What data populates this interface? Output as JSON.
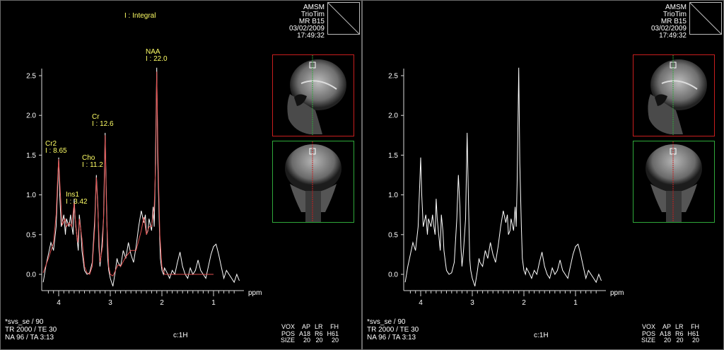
{
  "legend": "I : Integral",
  "info_lines": [
    "AMSM",
    "TrioTim",
    "MR B15",
    "03/02/2009",
    "17:49:32"
  ],
  "x_unit": "ppm",
  "x_ticks": [
    "4",
    "3",
    "2",
    "1"
  ],
  "y_ticks": [
    "0.0",
    "0.5",
    "1.0",
    "1.5",
    "2.0",
    "2.5"
  ],
  "peaks": [
    {
      "name": "Cr2",
      "integral": "I : 8.65"
    },
    {
      "name": "Ins1",
      "integral": "I : 3.42"
    },
    {
      "name": "Cho",
      "integral": "I : 11.2"
    },
    {
      "name": "Cr",
      "integral": "I : 12.6"
    },
    {
      "name": "NAA",
      "integral": "I : 22.0"
    }
  ],
  "protocol_lines": [
    "*svs_se / 90",
    "TR 2000 / TE 30",
    "NA 96 / TA 3:13"
  ],
  "nucleus": "c:1H",
  "voxel_table": {
    "headers": [
      "VOX",
      "AP",
      "LR",
      "FH"
    ],
    "rows": [
      [
        "POS",
        "A18",
        "R6",
        "H61"
      ],
      [
        "SIZE",
        "20",
        "20",
        "20"
      ]
    ]
  },
  "colors": {
    "spectrum": "#ffffff",
    "fit": "#e05050",
    "annotation": "#ffff66",
    "sagittal_frame": "#c81e1e",
    "coronal_frame": "#2fa83a"
  },
  "chart_data": [
    {
      "type": "line",
      "x_axis": "ppm (reversed)",
      "xlim": [
        4.3,
        0.45
      ],
      "ylim": [
        -0.2,
        2.6
      ],
      "x_ticks": [
        4,
        3,
        2,
        1
      ],
      "y_ticks": [
        0,
        0.5,
        1.0,
        1.5,
        2.0,
        2.5
      ],
      "series": [
        {
          "x": [
            4.3,
            4.25,
            4.2,
            4.15,
            4.1,
            4.05,
            4.02,
            4.0,
            3.98,
            3.95,
            3.9,
            3.87,
            3.85,
            3.8,
            3.77,
            3.75,
            3.72,
            3.7,
            3.68,
            3.65,
            3.62,
            3.6,
            3.57,
            3.55,
            3.52,
            3.5,
            3.47,
            3.45,
            3.4,
            3.35,
            3.3,
            3.27,
            3.24,
            3.22,
            3.2,
            3.17,
            3.13,
            3.1,
            3.07,
            3.05,
            3.03,
            3.0,
            2.95,
            2.9,
            2.87,
            2.85,
            2.8,
            2.75,
            2.7,
            2.65,
            2.6,
            2.55,
            2.5,
            2.45,
            2.4,
            2.35,
            2.32,
            2.3,
            2.27,
            2.25,
            2.2,
            2.17,
            2.15,
            2.13,
            2.1,
            2.08,
            2.05,
            2.03,
            2.0,
            1.97,
            1.95,
            1.9,
            1.85,
            1.8,
            1.75,
            1.7,
            1.65,
            1.6,
            1.55,
            1.5,
            1.45,
            1.4,
            1.35,
            1.3,
            1.25,
            1.2,
            1.15,
            1.1,
            1.05,
            1.0,
            0.95,
            0.9,
            0.85,
            0.8,
            0.75,
            0.7,
            0.65,
            0.6,
            0.55,
            0.5
          ],
          "y": [
            -0.1,
            0.1,
            0.25,
            0.4,
            0.3,
            0.6,
            1.1,
            1.47,
            1.0,
            0.6,
            0.75,
            0.5,
            0.7,
            0.6,
            0.75,
            0.62,
            0.5,
            0.95,
            0.7,
            0.5,
            0.3,
            0.75,
            0.55,
            0.3,
            0.15,
            0.05,
            0.02,
            0.0,
            0.02,
            0.15,
            0.7,
            1.25,
            0.85,
            0.35,
            0.1,
            0.3,
            0.7,
            1.78,
            0.8,
            0.2,
            0.05,
            -0.05,
            -0.15,
            0.05,
            0.2,
            0.15,
            0.1,
            0.3,
            0.2,
            0.4,
            0.25,
            0.15,
            0.35,
            0.6,
            0.8,
            0.65,
            0.75,
            0.5,
            0.55,
            0.7,
            0.55,
            0.85,
            0.6,
            1.2,
            2.6,
            1.4,
            0.6,
            0.2,
            0.05,
            0.0,
            0.08,
            0.02,
            -0.05,
            0.05,
            0.0,
            0.15,
            0.28,
            0.1,
            0.0,
            -0.05,
            0.08,
            0.0,
            0.05,
            0.18,
            0.05,
            0.0,
            -0.05,
            0.1,
            0.25,
            0.35,
            0.38,
            0.25,
            0.1,
            -0.05,
            0.05,
            0.0,
            -0.05,
            -0.1,
            0.0,
            -0.08
          ]
        },
        {
          "x": [
            4.3,
            4.2,
            4.1,
            4.05,
            4.02,
            4.0,
            3.97,
            3.93,
            3.88,
            3.85,
            3.8,
            3.75,
            3.7,
            3.67,
            3.63,
            3.6,
            3.55,
            3.5,
            3.45,
            3.4,
            3.35,
            3.3,
            3.27,
            3.24,
            3.2,
            3.15,
            3.12,
            3.1,
            3.07,
            3.03,
            3.0,
            2.95,
            2.9,
            2.85,
            2.8,
            2.7,
            2.6,
            2.5,
            2.4,
            2.35,
            2.3,
            2.25,
            2.2,
            2.15,
            2.12,
            2.1,
            2.07,
            2.04,
            2.0,
            1.95,
            1.9,
            1.8,
            1.7,
            1.6,
            1.5,
            1.4,
            1.3,
            1.2,
            1.1,
            1.0
          ],
          "y": [
            0.02,
            0.2,
            0.4,
            0.75,
            1.2,
            1.45,
            1.05,
            0.62,
            0.7,
            0.6,
            0.65,
            0.6,
            0.9,
            0.6,
            0.4,
            0.7,
            0.45,
            0.1,
            0.02,
            0.0,
            0.1,
            0.6,
            1.22,
            0.8,
            0.15,
            0.35,
            0.9,
            1.75,
            0.7,
            0.1,
            0.0,
            -0.02,
            0.05,
            0.12,
            0.1,
            0.22,
            0.3,
            0.3,
            0.55,
            0.72,
            0.5,
            0.6,
            0.6,
            0.85,
            1.4,
            2.55,
            1.3,
            0.5,
            0.1,
            0.0,
            0.0,
            0.0,
            0.0,
            0.0,
            0.0,
            0.0,
            0.0,
            0.0,
            0.0,
            0.0
          ]
        }
      ]
    },
    {
      "type": "line",
      "x_axis": "ppm (reversed)",
      "xlim": [
        4.3,
        0.45
      ],
      "ylim": [
        -0.2,
        2.6
      ],
      "x_ticks": [
        4,
        3,
        2,
        1
      ],
      "y_ticks": [
        0,
        0.5,
        1.0,
        1.5,
        2.0,
        2.5
      ],
      "series": [
        {
          "x": [
            4.3,
            4.25,
            4.2,
            4.15,
            4.1,
            4.05,
            4.02,
            4.0,
            3.98,
            3.95,
            3.9,
            3.87,
            3.85,
            3.8,
            3.77,
            3.75,
            3.72,
            3.7,
            3.68,
            3.65,
            3.62,
            3.6,
            3.57,
            3.55,
            3.52,
            3.5,
            3.47,
            3.45,
            3.4,
            3.35,
            3.3,
            3.27,
            3.24,
            3.22,
            3.2,
            3.17,
            3.13,
            3.1,
            3.07,
            3.05,
            3.03,
            3.0,
            2.95,
            2.9,
            2.87,
            2.85,
            2.8,
            2.75,
            2.7,
            2.65,
            2.6,
            2.55,
            2.5,
            2.45,
            2.4,
            2.35,
            2.32,
            2.3,
            2.27,
            2.25,
            2.2,
            2.17,
            2.15,
            2.13,
            2.1,
            2.08,
            2.05,
            2.03,
            2.0,
            1.97,
            1.95,
            1.9,
            1.85,
            1.8,
            1.75,
            1.7,
            1.65,
            1.6,
            1.55,
            1.5,
            1.45,
            1.4,
            1.35,
            1.3,
            1.25,
            1.2,
            1.15,
            1.1,
            1.05,
            1.0,
            0.95,
            0.9,
            0.85,
            0.8,
            0.75,
            0.7,
            0.65,
            0.6,
            0.55,
            0.5
          ],
          "y": [
            -0.1,
            0.1,
            0.25,
            0.4,
            0.3,
            0.6,
            1.1,
            1.47,
            1.0,
            0.6,
            0.75,
            0.5,
            0.7,
            0.6,
            0.75,
            0.62,
            0.5,
            0.95,
            0.7,
            0.5,
            0.3,
            0.75,
            0.55,
            0.3,
            0.15,
            0.05,
            0.02,
            0.0,
            0.02,
            0.15,
            0.7,
            1.25,
            0.85,
            0.35,
            0.1,
            0.3,
            0.7,
            1.78,
            0.8,
            0.2,
            0.05,
            -0.05,
            -0.15,
            0.05,
            0.2,
            0.15,
            0.1,
            0.3,
            0.2,
            0.4,
            0.25,
            0.15,
            0.35,
            0.6,
            0.8,
            0.65,
            0.75,
            0.5,
            0.55,
            0.7,
            0.55,
            0.85,
            0.6,
            1.2,
            2.6,
            1.4,
            0.6,
            0.2,
            0.05,
            0.0,
            0.08,
            0.02,
            -0.05,
            0.05,
            0.0,
            0.15,
            0.28,
            0.1,
            0.0,
            -0.05,
            0.08,
            0.0,
            0.05,
            0.18,
            0.05,
            0.0,
            -0.05,
            0.1,
            0.25,
            0.35,
            0.38,
            0.25,
            0.1,
            -0.05,
            0.05,
            0.0,
            -0.05,
            -0.1,
            0.0,
            -0.08
          ]
        }
      ]
    }
  ]
}
